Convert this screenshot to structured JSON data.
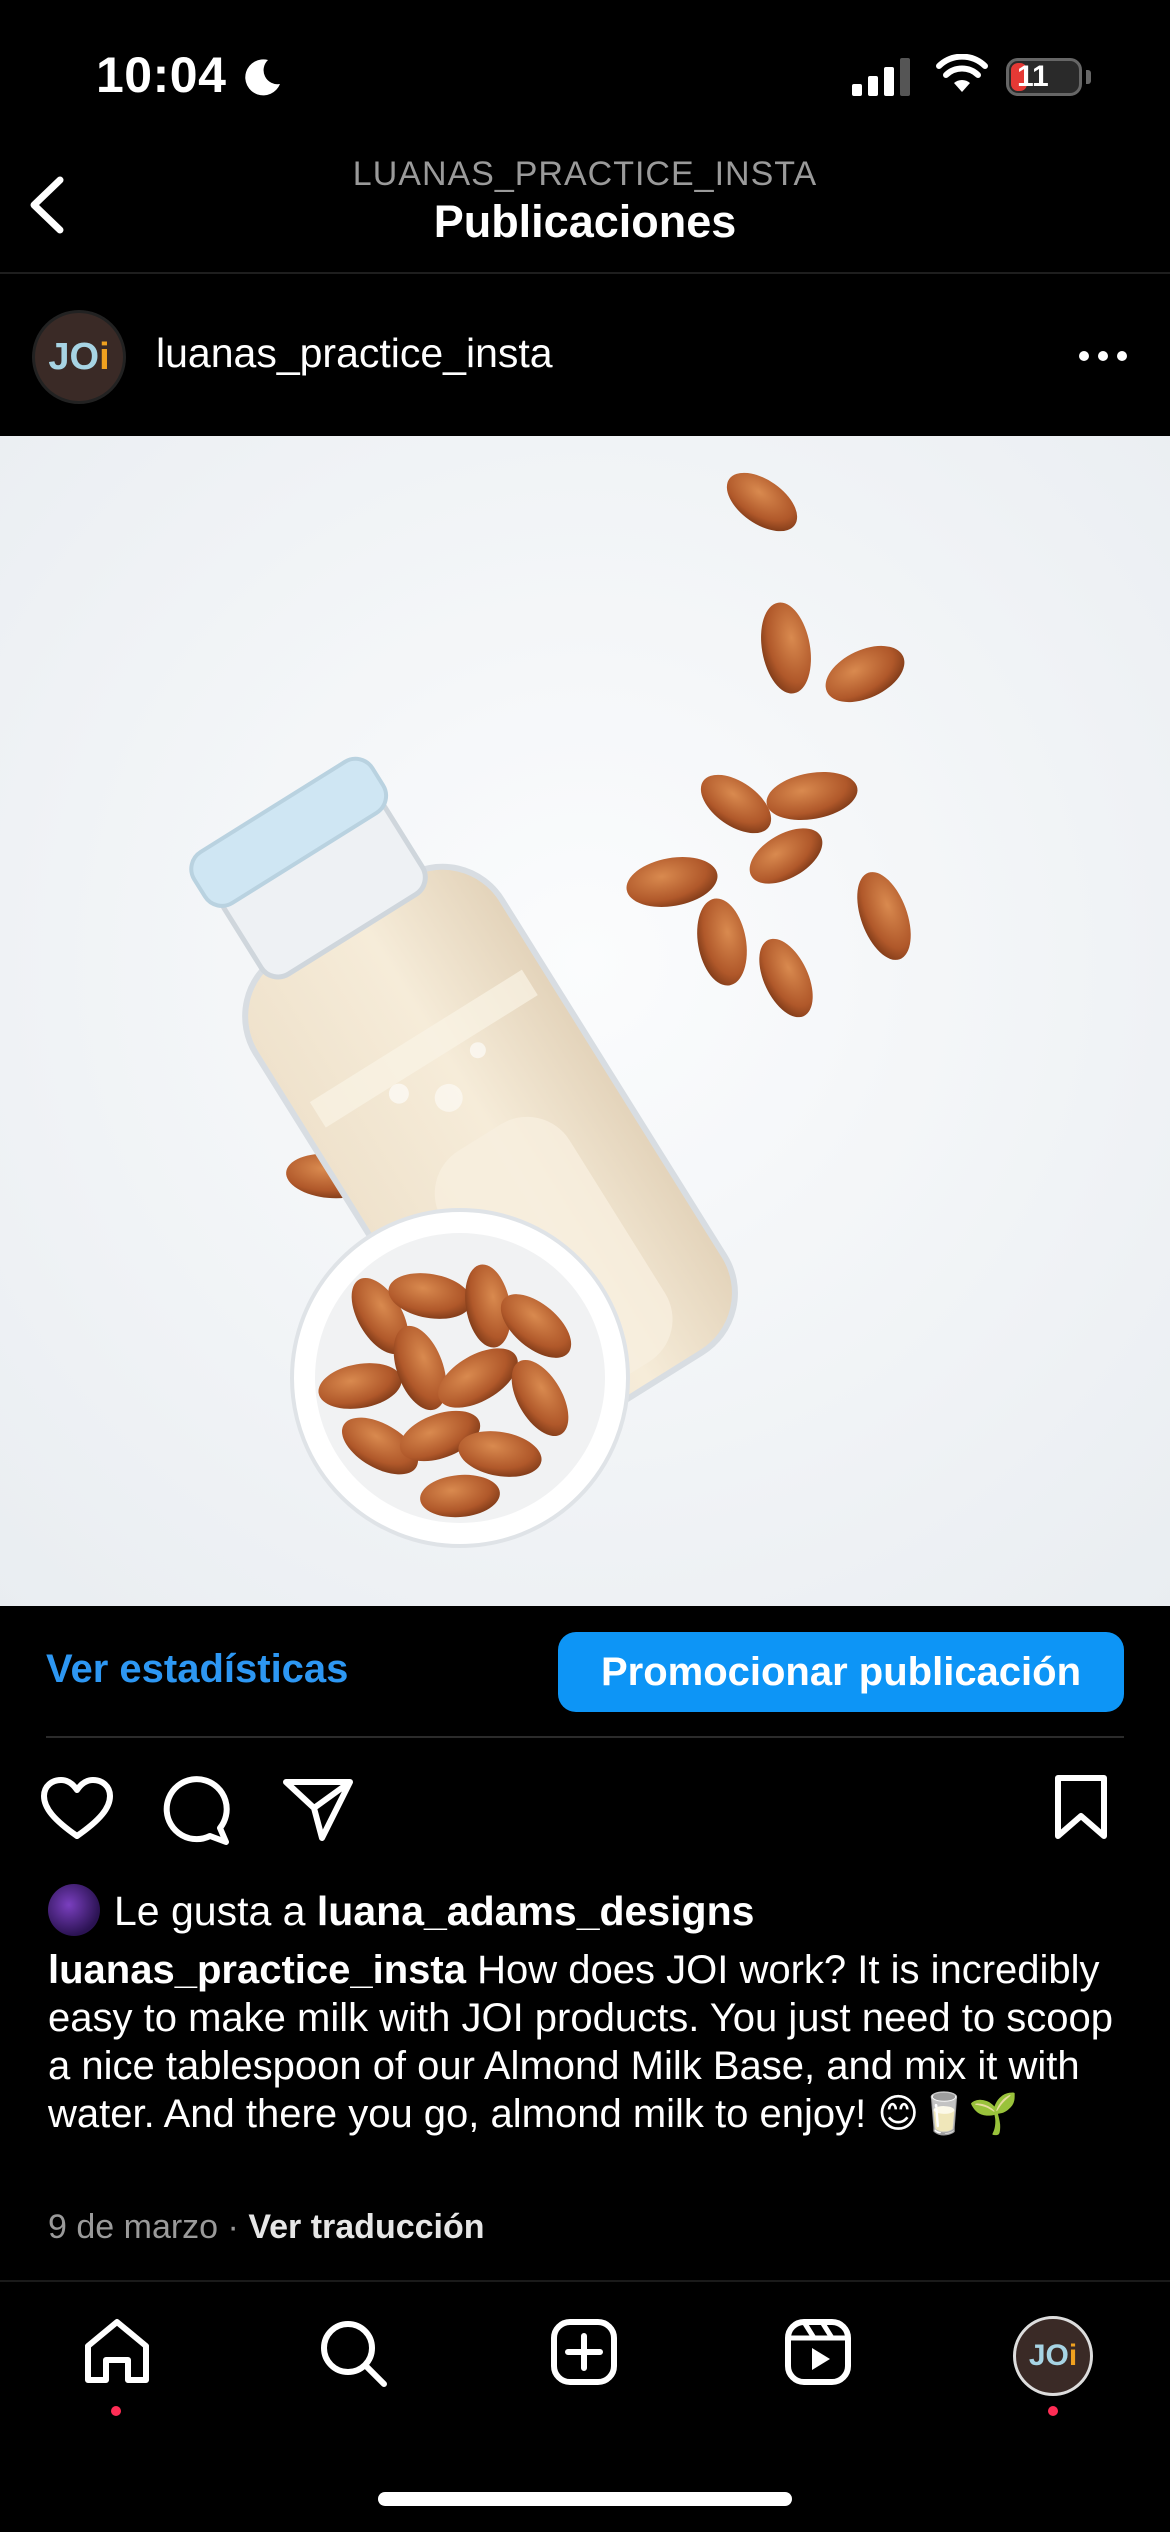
{
  "status_bar": {
    "time": "10:04",
    "battery": "11"
  },
  "header": {
    "subtitle": "LUANAS_PRACTICE_INSTA",
    "title": "Publicaciones"
  },
  "post": {
    "avatar_text": "JOi",
    "username": "luanas_practice_insta",
    "image_alt": "almond milk bottle with almonds",
    "stats_label": "Ver estadísticas",
    "promote_label": "Promocionar publicación",
    "liked_by_prefix": "Le gusta a",
    "liked_by_user": "luana_adams_designs",
    "caption_user": "luanas_practice_insta",
    "caption_text": " How does JOI work? It is incredibly easy to make milk with JOI products. You just need to scoop a nice tablespoon of our Almond Milk Base, and mix it with water. And there you go, almond milk to enjoy! 😊🥛🌱",
    "date": "9 de marzo",
    "separator": "·",
    "translate_label": "Ver traducción"
  },
  "tabbar": {
    "profile_text": "JOi"
  },
  "colors": {
    "accent": "#0d95f6",
    "link": "#2d97f3",
    "notification_dot": "#ff2d55"
  }
}
